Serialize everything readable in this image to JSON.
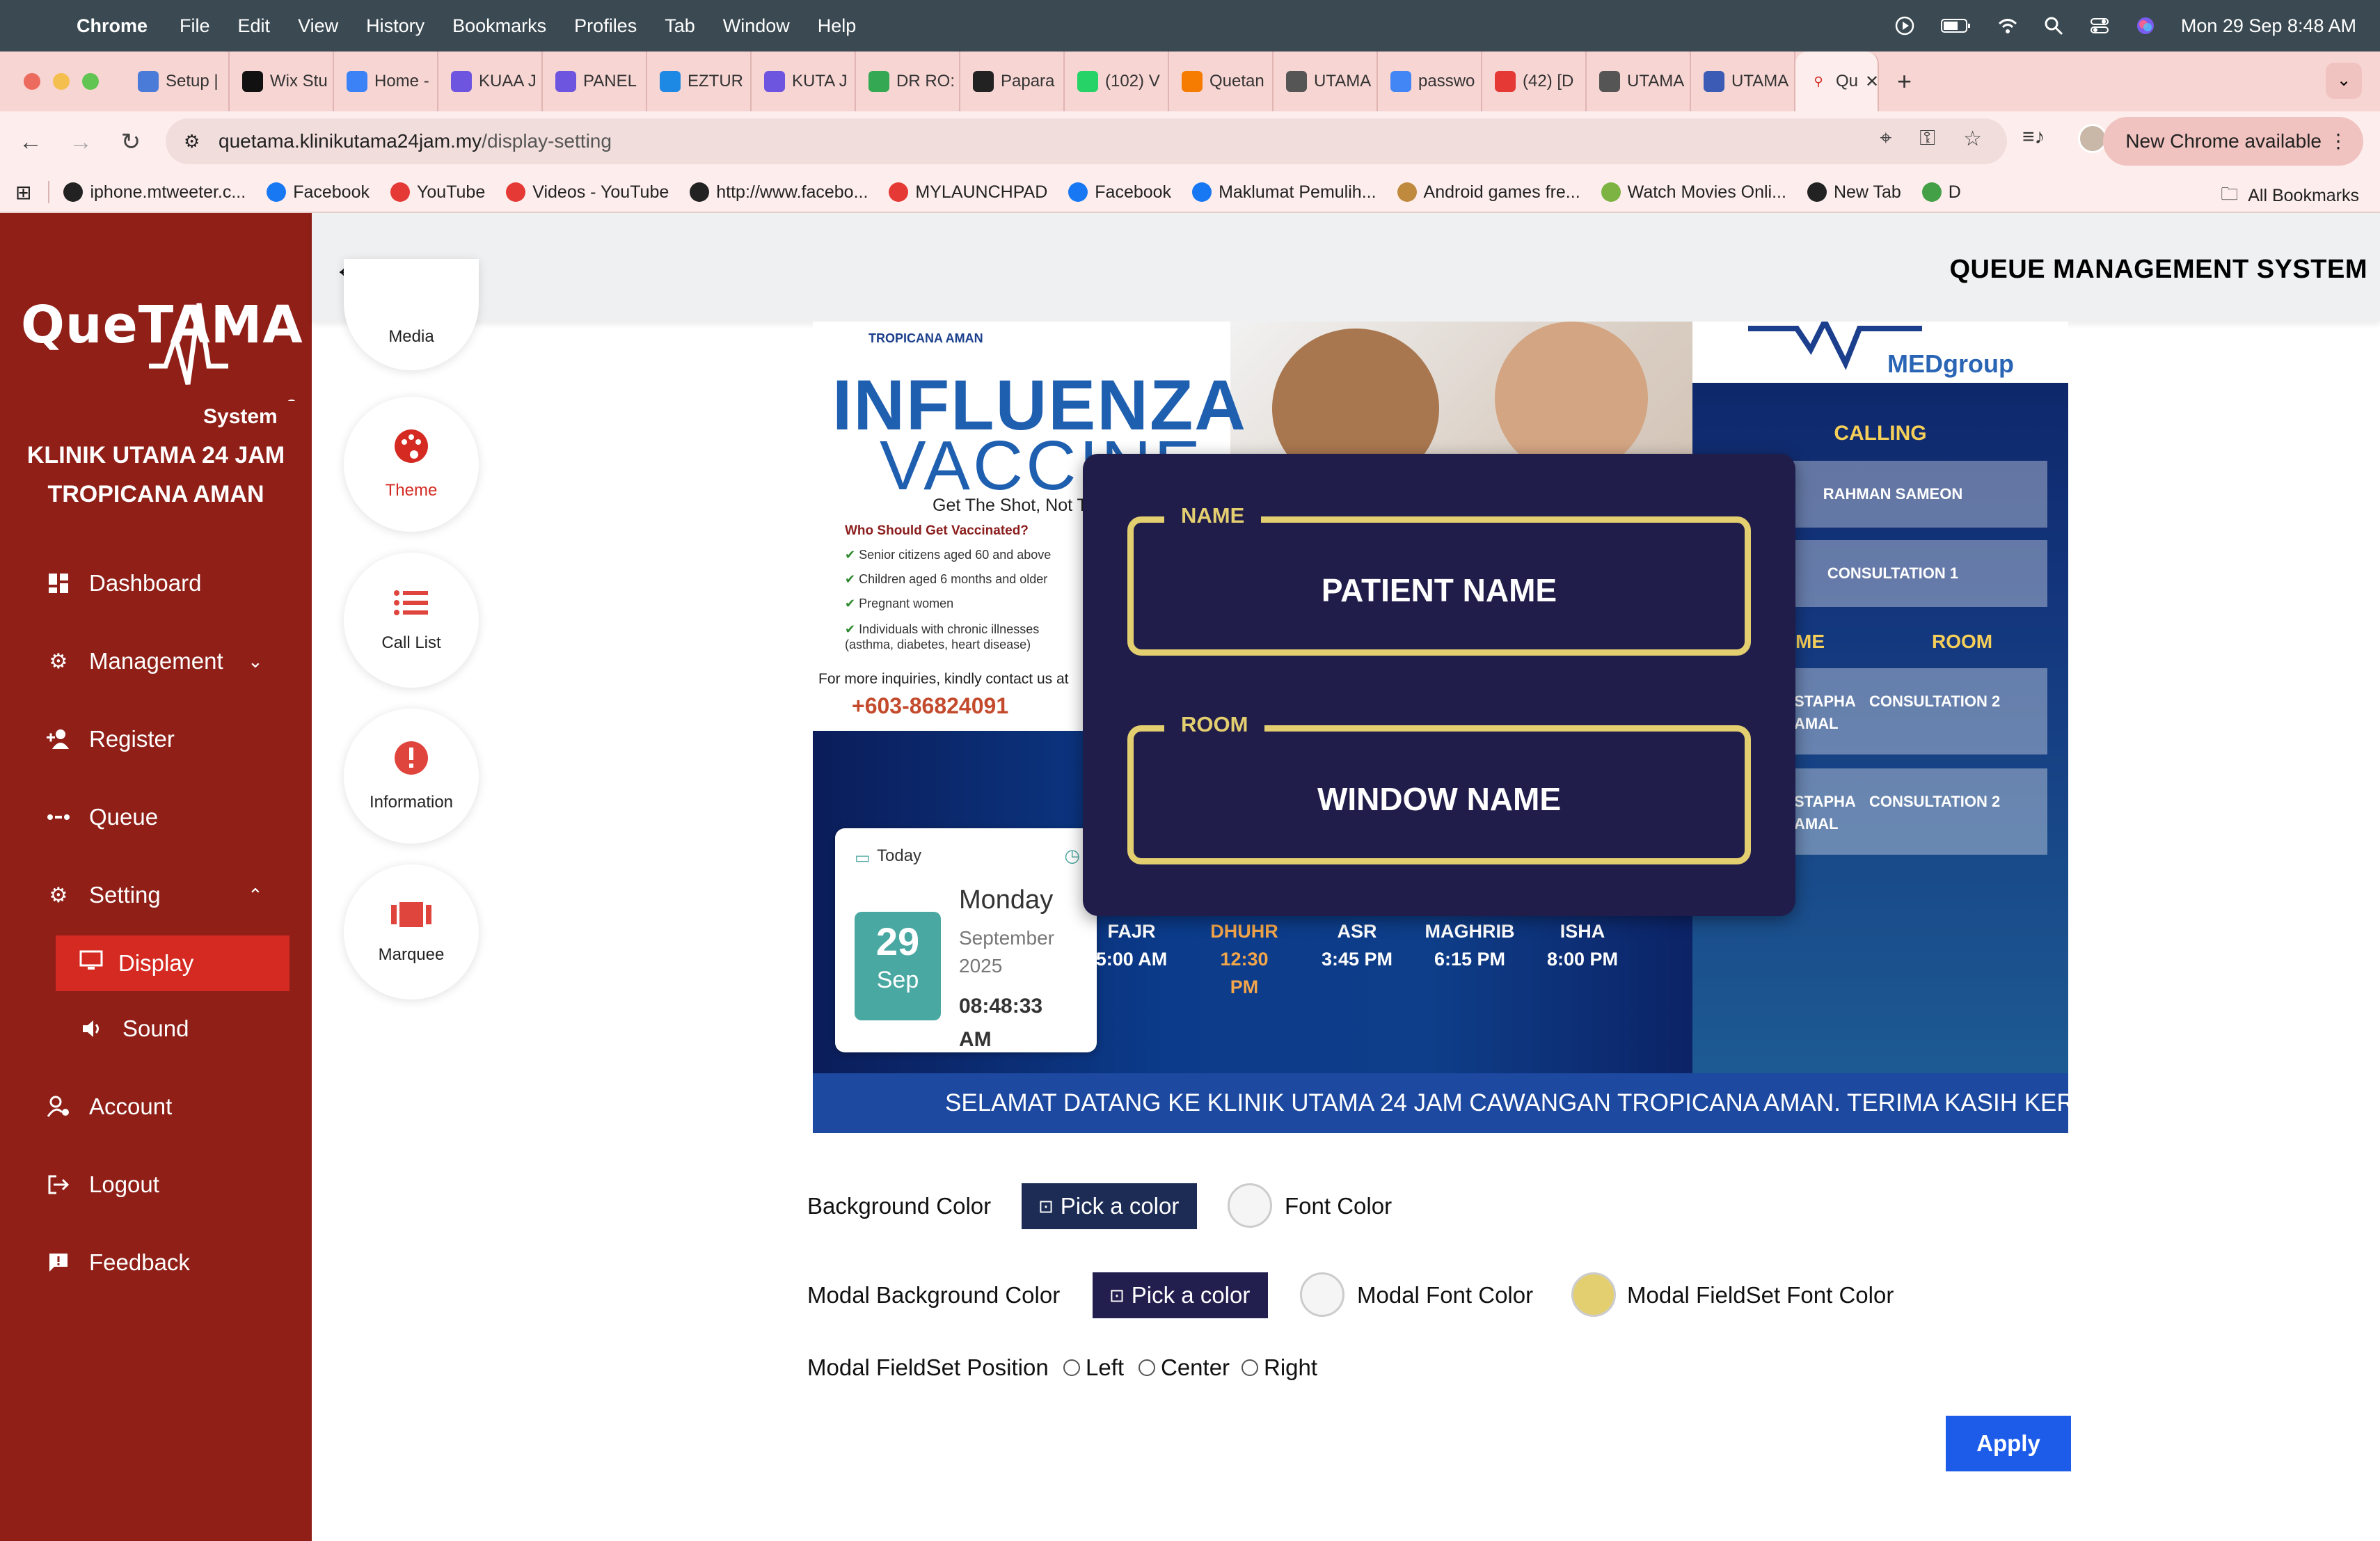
{
  "menubar": {
    "app": "Chrome",
    "items": [
      "File",
      "Edit",
      "View",
      "History",
      "Bookmarks",
      "Profiles",
      "Tab",
      "Window",
      "Help"
    ],
    "datetime": "Mon 29 Sep  8:48 AM"
  },
  "tabs": [
    {
      "label": "Setup |",
      "color": "#4a7bd9"
    },
    {
      "label": "Wix Stu",
      "color": "#111111"
    },
    {
      "label": "Home -",
      "color": "#3b82f6"
    },
    {
      "label": "KUAA J",
      "color": "#6d55e0"
    },
    {
      "label": "PANEL",
      "color": "#6d55e0"
    },
    {
      "label": "EZTUR",
      "color": "#1e88e5"
    },
    {
      "label": "KUTA J",
      "color": "#6d55e0"
    },
    {
      "label": "DR RO:",
      "color": "#34a853"
    },
    {
      "label": "Papara",
      "color": "#222222"
    },
    {
      "label": "(102) V",
      "color": "#25d366"
    },
    {
      "label": "Quetan",
      "color": "#f57c00"
    },
    {
      "label": "UTAMA",
      "color": "#555555"
    },
    {
      "label": "passwo",
      "color": "#4285f4"
    },
    {
      "label": "(42) [D",
      "color": "#e53935"
    },
    {
      "label": "UTAMA",
      "color": "#555555"
    },
    {
      "label": "UTAMA",
      "color": "#3b5bb5"
    }
  ],
  "active_tab": {
    "label": "Qu",
    "close": "✕"
  },
  "toolbar": {
    "url_domain": "quetama.klinikutama24jam.my",
    "url_path": "/display-setting",
    "new_chrome": "New Chrome available"
  },
  "bookmarks": [
    {
      "label": "iphone.mtweeter.c...",
      "color": "#222222"
    },
    {
      "label": "Facebook",
      "color": "#1877f2"
    },
    {
      "label": "YouTube",
      "color": "#e53935"
    },
    {
      "label": "Videos - YouTube",
      "color": "#e53935"
    },
    {
      "label": "http://www.facebo...",
      "color": "#222222"
    },
    {
      "label": "MYLAUNCHPAD",
      "color": "#e53935"
    },
    {
      "label": "Facebook",
      "color": "#1877f2"
    },
    {
      "label": "Maklumat Pemulih...",
      "color": "#1877f2"
    },
    {
      "label": "Android games fre...",
      "color": "#c08a3e"
    },
    {
      "label": "Watch Movies Onli...",
      "color": "#7cb342"
    },
    {
      "label": "New Tab",
      "color": "#222222"
    },
    {
      "label": "D",
      "color": "#43a047"
    }
  ],
  "all_bookmarks": "All Bookmarks",
  "sidebar": {
    "logo_text": "QueTAMA",
    "logo_sub": "System",
    "clinic_line1": "KLINIK UTAMA 24 JAM",
    "clinic_line2": "TROPICANA AMAN",
    "items": {
      "dashboard": "Dashboard",
      "management": "Management",
      "register": "Register",
      "queue": "Queue",
      "setting": "Setting",
      "display": "Display",
      "sound": "Sound",
      "account": "Account",
      "logout": "Logout",
      "feedback": "Feedback"
    }
  },
  "header": {
    "title": "QUEUE MANAGEMENT SYSTEM"
  },
  "tools": {
    "media": "Media",
    "theme": "Theme",
    "call_list": "Call List",
    "information": "Information",
    "marquee": "Marquee"
  },
  "preview": {
    "poster": {
      "brand": "TROPICANA AMAN",
      "title1": "INFLUENZA",
      "title2": "VACCINE",
      "tagline": "Get The Shot, Not T",
      "who": "Who Should Get Vaccinated?",
      "bullets": [
        "Senior citizens aged 60 and above",
        "Children aged 6 months and older",
        "Pregnant women",
        "Individuals with chronic illnesses (asthma, diabetes, heart disease)"
      ],
      "inquiry": "For more inquiries, kindly contact us at",
      "phone": "+603-86824091"
    },
    "right": {
      "brand": "MEDgroup",
      "calling": "CALLING",
      "calling_name": "RAHMAN SAMEON",
      "calling_room": "CONSULTATION 1",
      "col_name": "ME",
      "col_room": "ROOM",
      "rows": [
        {
          "name1": "STAPHA",
          "name2": "AMAL",
          "room": "CONSULTATION 2"
        },
        {
          "name1": "STAPHA",
          "name2": "AMAL",
          "room": "CONSULTATION 2"
        }
      ]
    },
    "date": {
      "today": "Today",
      "day_num": "29",
      "month_short": "Sep",
      "weekday": "Monday",
      "month_full": "September",
      "year": "2025",
      "time": "08:48:33",
      "ampm": "AM"
    },
    "prayer": [
      {
        "name": "FAJR",
        "time": "5:00 AM"
      },
      {
        "name": "DHUHR",
        "time": "12:30 PM"
      },
      {
        "name": "ASR",
        "time": "3:45 PM"
      },
      {
        "name": "MAGHRIB",
        "time": "6:15 PM"
      },
      {
        "name": "ISHA",
        "time": "8:00 PM"
      }
    ],
    "marquee": "SELAMAT DATANG KE KLINIK UTAMA 24 JAM CAWANGAN TROPICANA AMAN. TERIMA KASIH KER"
  },
  "modal": {
    "name_legend": "NAME",
    "name_value": "PATIENT NAME",
    "room_legend": "ROOM",
    "room_value": "WINDOW NAME"
  },
  "form": {
    "bg_color_label": "Background Color",
    "pick_label": "Pick a color",
    "font_color_label": "Font Color",
    "modal_bg_label": "Modal Background Color",
    "modal_pick_label": "Pick a color",
    "modal_font_label": "Modal Font Color",
    "modal_fieldset_font_label": "Modal FieldSet Font Color",
    "position_label": "Modal FieldSet Position",
    "positions": [
      "Left",
      "Center",
      "Right"
    ],
    "apply": "Apply",
    "colors": {
      "background": "#1c2c55",
      "font": "#f5f5f5",
      "modal_background": "#221f4e",
      "modal_font": "#f5f5f5",
      "modal_fieldset_font": "#e4cf70"
    }
  }
}
